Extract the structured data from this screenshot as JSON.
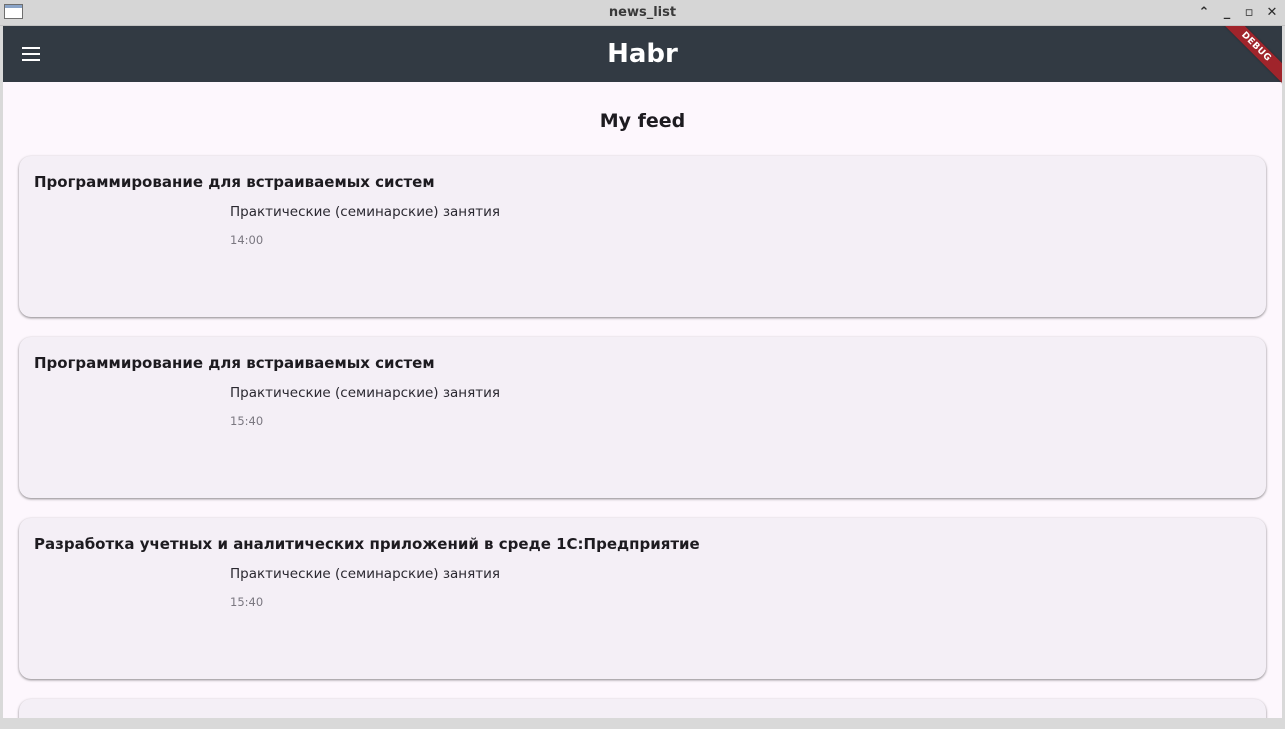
{
  "window": {
    "title": "news_list",
    "controls": {
      "up": "⌃",
      "minimize": "_",
      "maximize": "▫",
      "close": "✕"
    }
  },
  "appbar": {
    "title": "Habr",
    "menu_icon": "hamburger-menu-icon",
    "debug_banner": "DEBUG",
    "background": "#323a43"
  },
  "feed": {
    "heading": "My feed",
    "items": [
      {
        "title": "Программирование для встраиваемых систем",
        "subtitle": "Практические (семинарские) занятия",
        "time": "14:00"
      },
      {
        "title": "Программирование для встраиваемых систем",
        "subtitle": "Практические (семинарские) занятия",
        "time": "15:40"
      },
      {
        "title": "Разработка учетных и аналитических приложений в среде 1С:Предприятие",
        "subtitle": "Практические (семинарские) занятия",
        "time": "15:40"
      }
    ]
  },
  "colors": {
    "page_background": "#fdf7fd",
    "card_background": "#f4eff6",
    "debug_ribbon": "#a0242b"
  }
}
